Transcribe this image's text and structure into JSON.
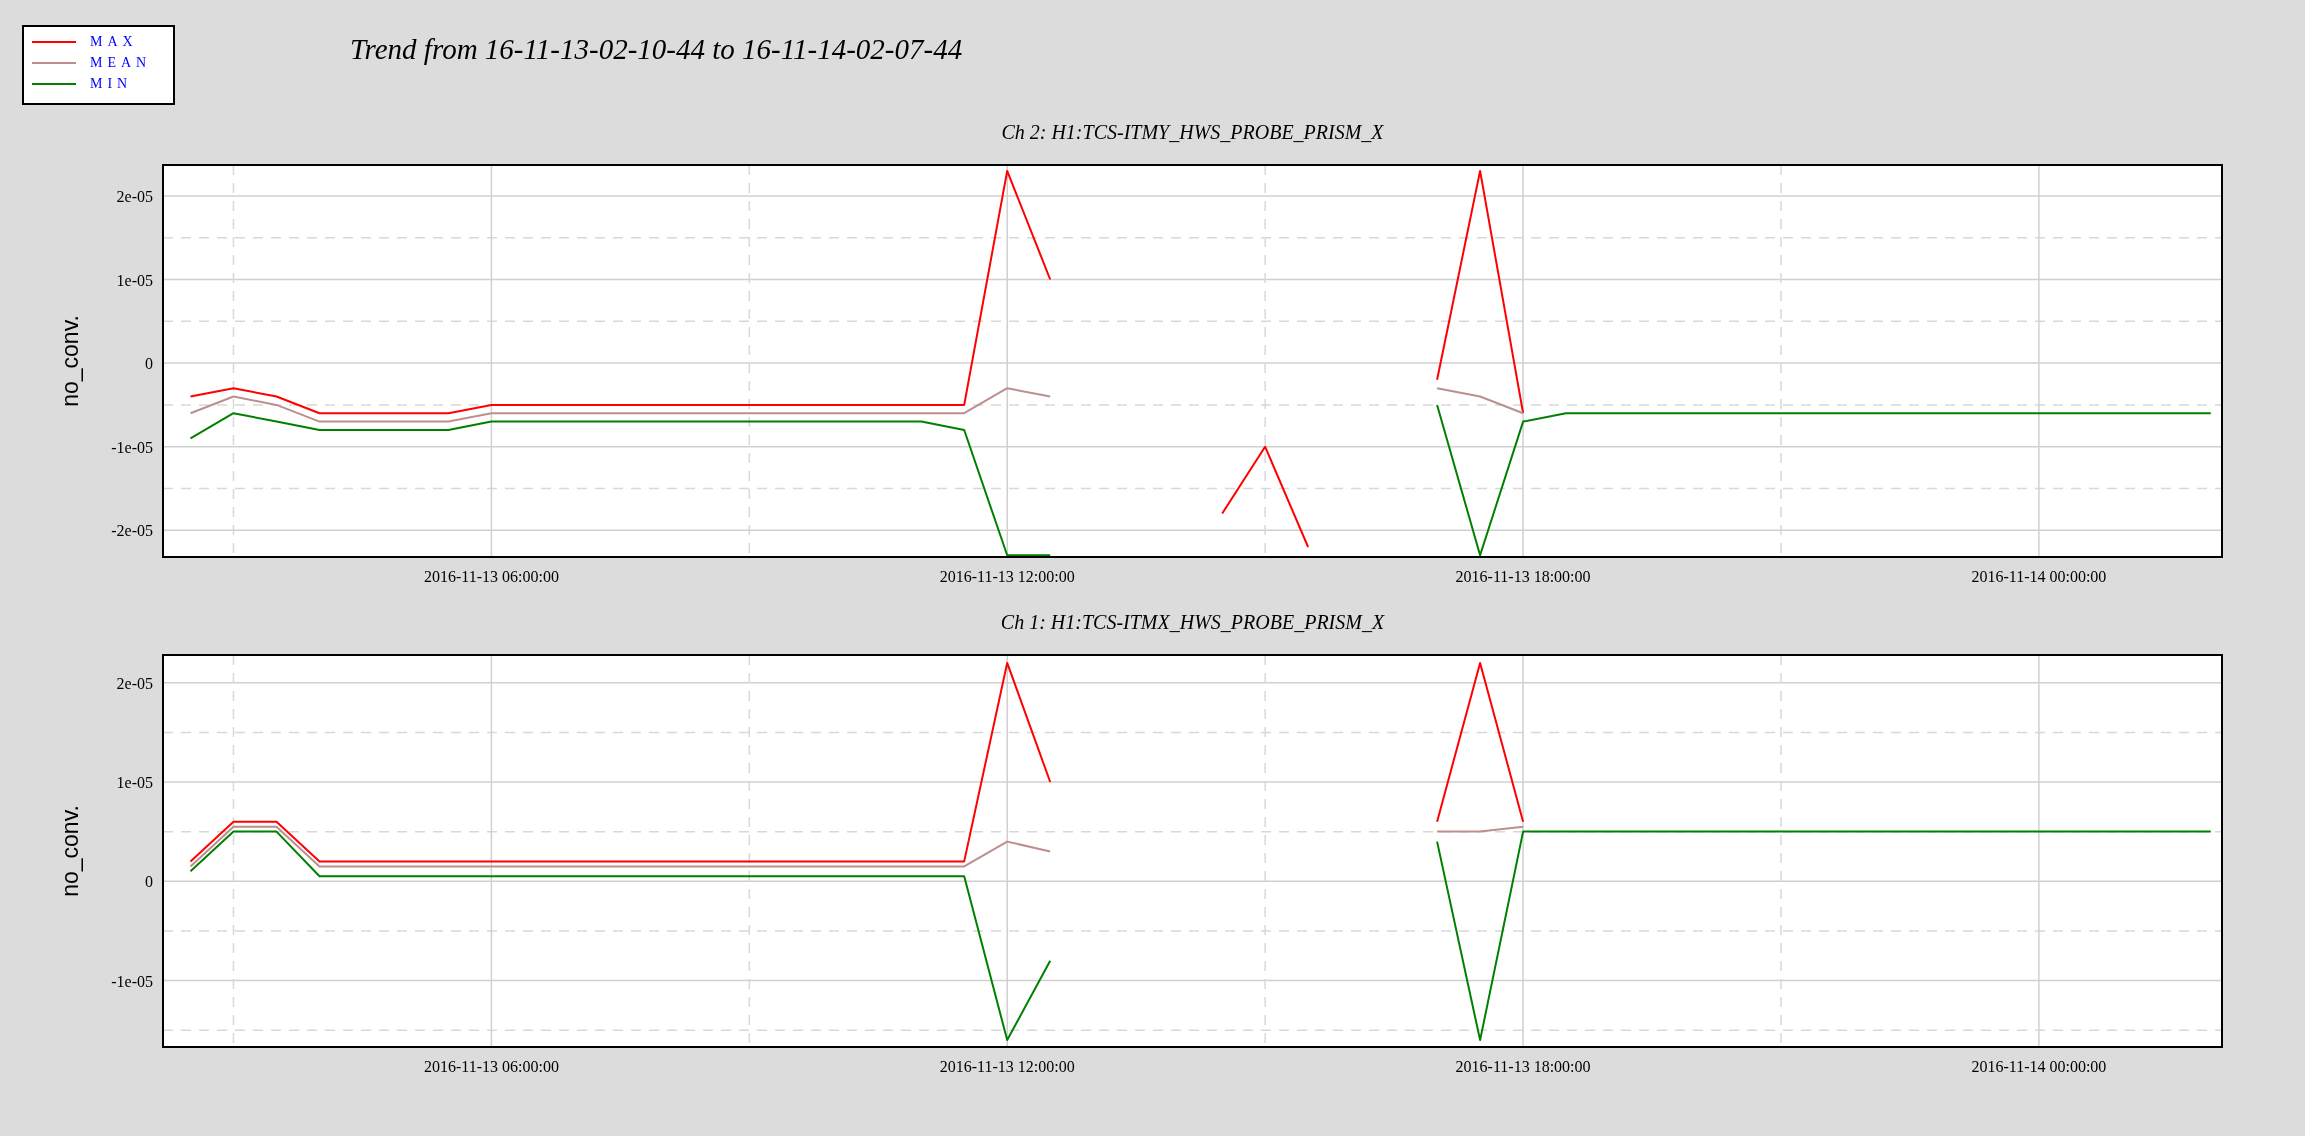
{
  "legend": [
    {
      "label": "MAX",
      "color": "#ff0000"
    },
    {
      "label": "MEAN",
      "color": "#bc8f8f"
    },
    {
      "label": "MIN",
      "color": "#008000"
    }
  ],
  "title": "Trend from 16-11-13-02-10-44 to 16-11-14-02-07-44",
  "charts": [
    {
      "chart_data": {
        "type": "line",
        "title": "Ch 2: H1:TCS-ITMY_HWS_PROBE_PRISM_X",
        "ylabel": "no_conv.",
        "grid": true,
        "categories": [
          null,
          null,
          null,
          null,
          null,
          null,
          null,
          "2016-11-13 06:00:00",
          null,
          null,
          null,
          null,
          null,
          null,
          null,
          null,
          null,
          null,
          null,
          "2016-11-13 12:00:00",
          null,
          null,
          null,
          null,
          null,
          null,
          null,
          null,
          null,
          null,
          null,
          "2016-11-13 18:00:00",
          null,
          null,
          null,
          null,
          null,
          null,
          null,
          null,
          null,
          null,
          null,
          "2016-11-14 00:00:00",
          null,
          null,
          null,
          null
        ],
        "series": [
          {
            "color": "#ff0000",
            "values": [
              -4e-06,
              -3e-06,
              -4e-06,
              -6e-06,
              -6e-06,
              -6e-06,
              -6e-06,
              -5e-06,
              -5e-06,
              -5e-06,
              -5e-06,
              -5e-06,
              -5e-06,
              -5e-06,
              -5e-06,
              -5e-06,
              -5e-06,
              -5e-06,
              -5e-06,
              2.3e-05,
              1e-05,
              null,
              null,
              null,
              -1.8e-05,
              -1e-05,
              -2.2e-05,
              null,
              null,
              -2e-06,
              2.3e-05,
              -6e-06,
              null,
              null,
              null,
              null,
              null,
              null,
              null,
              null,
              null,
              null,
              null,
              null,
              null,
              null,
              null,
              null
            ]
          },
          {
            "color": "#bc8f8f",
            "values": [
              -6e-06,
              -4e-06,
              -5e-06,
              -7e-06,
              -7e-06,
              -7e-06,
              -7e-06,
              -6e-06,
              -6e-06,
              -6e-06,
              -6e-06,
              -6e-06,
              -6e-06,
              -6e-06,
              -6e-06,
              -6e-06,
              -6e-06,
              -6e-06,
              -6e-06,
              -3e-06,
              -4e-06,
              null,
              null,
              null,
              null,
              null,
              null,
              null,
              null,
              -3e-06,
              -4e-06,
              -6e-06,
              null,
              null,
              null,
              null,
              null,
              null,
              null,
              null,
              null,
              null,
              null,
              null,
              null,
              null,
              null,
              null
            ]
          },
          {
            "color": "#008000",
            "values": [
              -9e-06,
              -6e-06,
              -7e-06,
              -8e-06,
              -8e-06,
              -8e-06,
              -8e-06,
              -7e-06,
              -7e-06,
              -7e-06,
              -7e-06,
              -7e-06,
              -7e-06,
              -7e-06,
              -7e-06,
              -7e-06,
              -7e-06,
              -7e-06,
              -8e-06,
              -2.3e-05,
              -2.3e-05,
              null,
              null,
              null,
              null,
              null,
              null,
              null,
              null,
              -5e-06,
              -2.3e-05,
              -7e-06,
              -6e-06,
              -6e-06,
              -6e-06,
              -6e-06,
              -6e-06,
              -6e-06,
              -6e-06,
              -6e-06,
              -6e-06,
              -6e-06,
              -6e-06,
              -6e-06,
              -6e-06,
              -6e-06,
              -6e-06,
              -6e-06
            ]
          }
        ],
        "ylim": [
          -2.32e-05,
          2.37e-05
        ],
        "yticks": [
          {
            "value": -2e-05,
            "label": "-2e-05"
          },
          {
            "value": -1e-05,
            "label": "-1e-05"
          },
          {
            "value": 0,
            "label": "0"
          },
          {
            "value": 1e-05,
            "label": "1e-05"
          },
          {
            "value": 2e-05,
            "label": "2e-05"
          }
        ]
      }
    },
    {
      "chart_data": {
        "type": "line",
        "title": "Ch 1: H1:TCS-ITMX_HWS_PROBE_PRISM_X",
        "ylabel": "no_conv.",
        "grid": true,
        "categories": [
          null,
          null,
          null,
          null,
          null,
          null,
          null,
          "2016-11-13 06:00:00",
          null,
          null,
          null,
          null,
          null,
          null,
          null,
          null,
          null,
          null,
          null,
          "2016-11-13 12:00:00",
          null,
          null,
          null,
          null,
          null,
          null,
          null,
          null,
          null,
          null,
          null,
          "2016-11-13 18:00:00",
          null,
          null,
          null,
          null,
          null,
          null,
          null,
          null,
          null,
          null,
          null,
          "2016-11-14 00:00:00",
          null,
          null,
          null,
          null
        ],
        "series": [
          {
            "color": "#ff0000",
            "values": [
              2e-06,
              6e-06,
              6e-06,
              2e-06,
              2e-06,
              2e-06,
              2e-06,
              2e-06,
              2e-06,
              2e-06,
              2e-06,
              2e-06,
              2e-06,
              2e-06,
              2e-06,
              2e-06,
              2e-06,
              2e-06,
              2e-06,
              2.2e-05,
              1e-05,
              null,
              null,
              null,
              null,
              null,
              null,
              null,
              null,
              6e-06,
              2.2e-05,
              6e-06,
              null,
              null,
              null,
              null,
              null,
              null,
              null,
              null,
              null,
              null,
              null,
              null,
              null,
              null,
              null,
              null
            ]
          },
          {
            "color": "#bc8f8f",
            "values": [
              1.5e-06,
              5.5e-06,
              5.5e-06,
              1.5e-06,
              1.5e-06,
              1.5e-06,
              1.5e-06,
              1.5e-06,
              1.5e-06,
              1.5e-06,
              1.5e-06,
              1.5e-06,
              1.5e-06,
              1.5e-06,
              1.5e-06,
              1.5e-06,
              1.5e-06,
              1.5e-06,
              1.5e-06,
              4e-06,
              3e-06,
              null,
              null,
              null,
              null,
              null,
              null,
              null,
              null,
              5e-06,
              5e-06,
              5.5e-06,
              null,
              null,
              null,
              null,
              null,
              null,
              null,
              null,
              null,
              null,
              null,
              null,
              null,
              null,
              null,
              null
            ]
          },
          {
            "color": "#008000",
            "values": [
              1e-06,
              5e-06,
              5e-06,
              5e-07,
              5e-07,
              5e-07,
              5e-07,
              5e-07,
              5e-07,
              5e-07,
              5e-07,
              5e-07,
              5e-07,
              5e-07,
              5e-07,
              5e-07,
              5e-07,
              5e-07,
              5e-07,
              -1.6e-05,
              -8e-06,
              null,
              null,
              null,
              null,
              null,
              null,
              null,
              null,
              4e-06,
              -1.6e-05,
              5e-06,
              5e-06,
              5e-06,
              5e-06,
              5e-06,
              5e-06,
              5e-06,
              5e-06,
              5e-06,
              5e-06,
              5e-06,
              5e-06,
              5e-06,
              5e-06,
              5e-06,
              5e-06,
              5e-06
            ]
          }
        ],
        "ylim": [
          -1.67e-05,
          2.28e-05
        ],
        "yticks": [
          {
            "value": -1e-05,
            "label": "-1e-05"
          },
          {
            "value": 0,
            "label": "0"
          },
          {
            "value": 1e-05,
            "label": "1e-05"
          },
          {
            "value": 2e-05,
            "label": "2e-05"
          }
        ]
      }
    }
  ]
}
